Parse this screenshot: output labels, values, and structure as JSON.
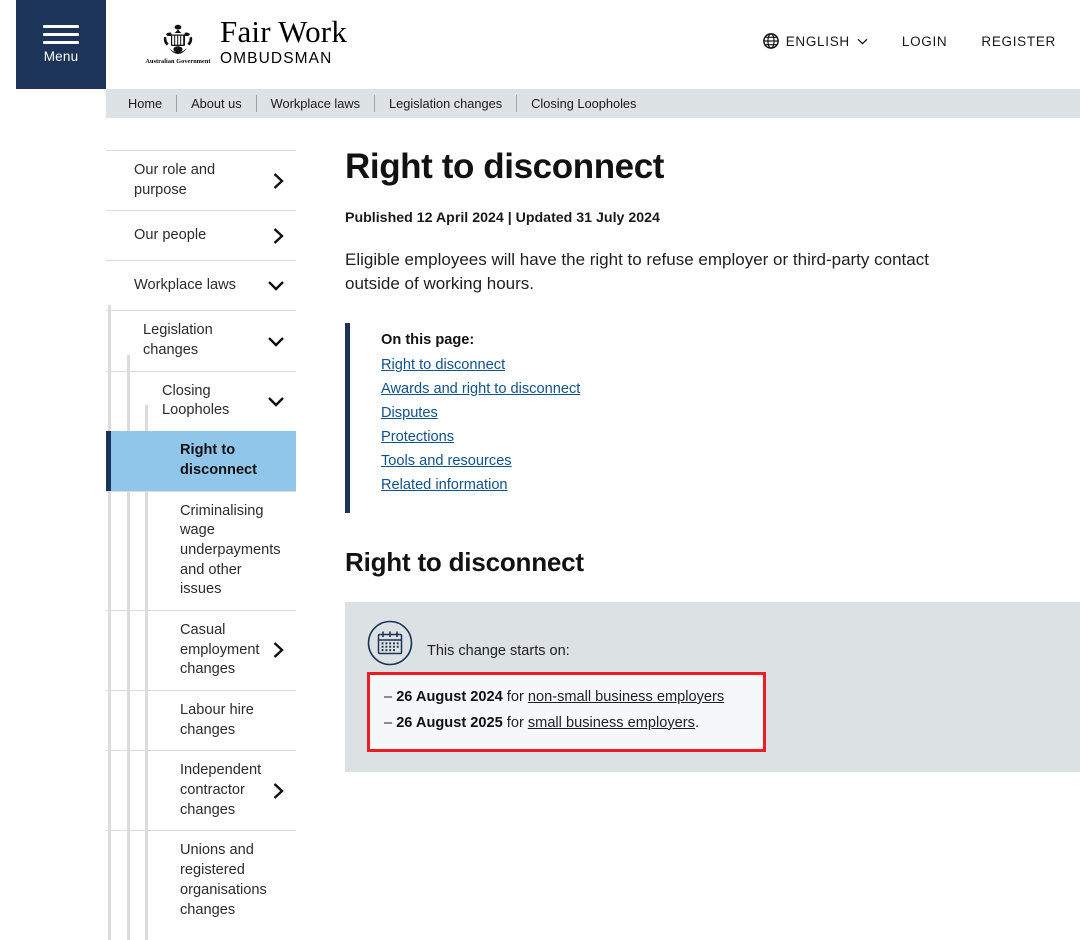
{
  "header": {
    "menu_label": "Menu",
    "brand_main": "Fair Work",
    "brand_sub": "OMBUDSMAN",
    "crest_caption": "Australian Government",
    "language": "ENGLISH",
    "login": "LOGIN",
    "register": "REGISTER"
  },
  "breadcrumb": {
    "items": [
      {
        "label": "Home"
      },
      {
        "label": "About us"
      },
      {
        "label": "Workplace laws"
      },
      {
        "label": "Legislation changes"
      },
      {
        "label": "Closing Loopholes"
      }
    ]
  },
  "sidebar": {
    "items": [
      {
        "label": "Our role and purpose",
        "level": 0,
        "icon": "chevron-right-icon",
        "active": false
      },
      {
        "label": "Our people",
        "level": 0,
        "icon": "chevron-right-icon",
        "active": false
      },
      {
        "label": "Workplace laws",
        "level": 0,
        "icon": "chevron-down-icon",
        "active": false
      },
      {
        "label": "Legislation changes",
        "level": 1,
        "icon": "chevron-down-icon",
        "active": false
      },
      {
        "label": "Closing Loopholes",
        "level": 2,
        "icon": "chevron-down-icon",
        "active": false
      },
      {
        "label": "Right to disconnect",
        "level": 3,
        "icon": "",
        "active": true
      },
      {
        "label": "Criminalising wage underpayments and other issues",
        "level": 3,
        "icon": "",
        "active": false
      },
      {
        "label": "Casual employment changes",
        "level": 3,
        "icon": "chevron-right-icon",
        "active": false
      },
      {
        "label": "Labour hire changes",
        "level": 3,
        "icon": "",
        "active": false
      },
      {
        "label": "Independent contractor changes",
        "level": 3,
        "icon": "chevron-right-icon",
        "active": false
      },
      {
        "label": "Unions and registered organisations changes",
        "level": 3,
        "icon": "",
        "active": false
      }
    ]
  },
  "main": {
    "title": "Right to disconnect",
    "meta": "Published 12 April 2024 | Updated 31 July 2024",
    "lead": "Eligible employees will have the right to refuse employer or third-party contact outside of working hours.",
    "on_this_page": {
      "title": "On this page:",
      "links": [
        "Right to disconnect",
        "Awards and right to disconnect",
        "Disputes",
        "Protections",
        "Tools and resources",
        "Related information"
      ]
    },
    "section_heading": "Right to disconnect",
    "infobox": {
      "icon": "calendar-icon",
      "intro": "This change starts on:",
      "rows": [
        {
          "dash": "–",
          "date": "26 August 2024",
          "mid": " for ",
          "link": "non-small business employers",
          "tail": ""
        },
        {
          "dash": "–",
          "date": "26 August 2025",
          "mid": " for ",
          "link": "small business employers",
          "tail": "."
        }
      ]
    }
  },
  "colors": {
    "navy": "#1b3458",
    "breadcrumb_bg": "#dde2e4",
    "active_nav": "#8fc6e9",
    "infobox_bg": "#dce1e3",
    "highlight_red": "#ed1c24",
    "link_blue": "#11518c"
  }
}
